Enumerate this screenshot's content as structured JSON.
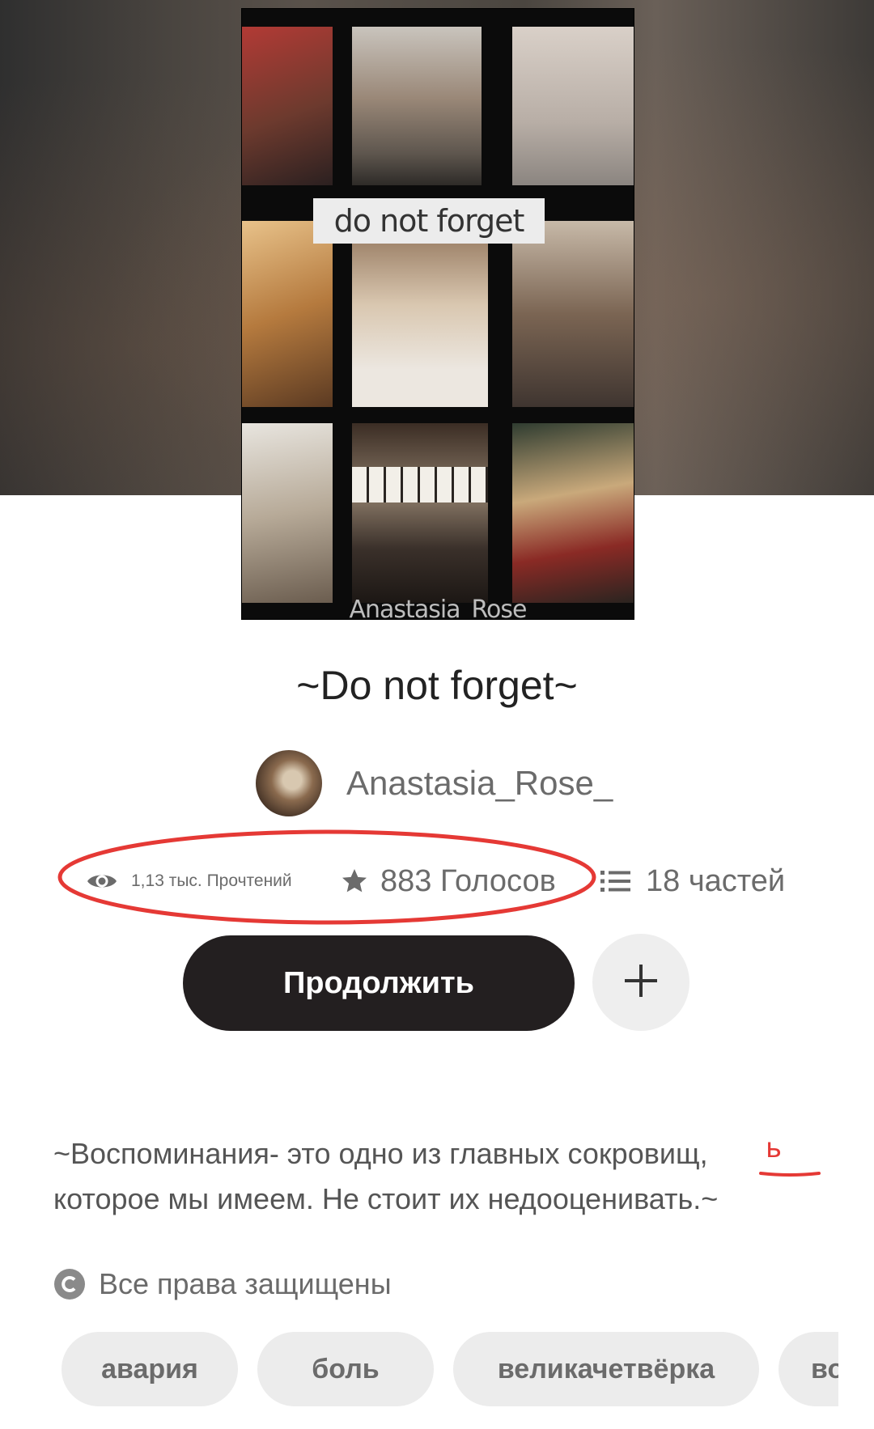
{
  "cover": {
    "title_text": "do not forget",
    "author_text": "Anastasia_Rose"
  },
  "story": {
    "title": "~Do not forget~",
    "author": "Anastasia_Rose_"
  },
  "stats": {
    "reads": "1,13 тыс. Прочтений",
    "votes": "883 Голосов",
    "parts": "18 частей"
  },
  "actions": {
    "continue_label": "Продолжить",
    "add_label": "+"
  },
  "description": {
    "line1": "~Воспоминания- это одно из главных сокровищ,",
    "line2": "которое мы имеем. Не стоит их недооценивать.~"
  },
  "copyright": {
    "label": "Все права защищены"
  },
  "tags": [
    "авария",
    "боль",
    "великачетвёрка",
    "во"
  ],
  "annotations": {
    "correction_mark": "ь",
    "color": "#e53935"
  },
  "icons": {
    "reads": "eye-icon",
    "votes": "star-icon",
    "parts": "list-icon",
    "copyright": "copyright-icon",
    "add": "plus-icon"
  }
}
